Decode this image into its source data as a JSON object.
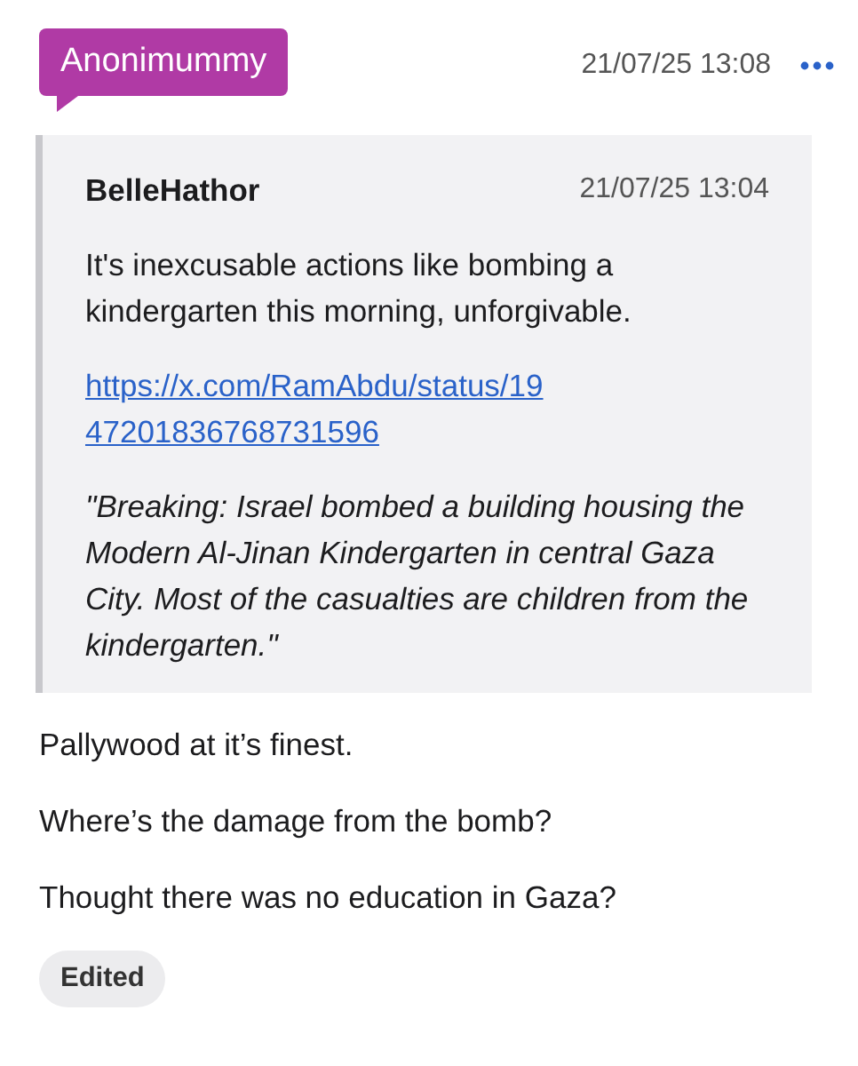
{
  "post": {
    "author": "Anonimummy",
    "timestamp": "21/07/25 13:08",
    "quote": {
      "author": "BelleHathor",
      "timestamp": "21/07/25 13:04",
      "text": "It's inexcusable actions like bombing a kindergarten this morning, unforgivable.",
      "link": "https://x.com/RamAbdu/status/1947201836768731596",
      "embed_text": "\"Breaking: Israel bombed a building housing the Modern Al-Jinan Kindergarten in central Gaza City. Most of the casualties are children from the kindergarten.\""
    },
    "body": [
      "Pallywood at it’s finest.",
      "Where’s the damage from the bomb?",
      "Thought there was no education in Gaza?"
    ],
    "edited_label": "Edited"
  }
}
